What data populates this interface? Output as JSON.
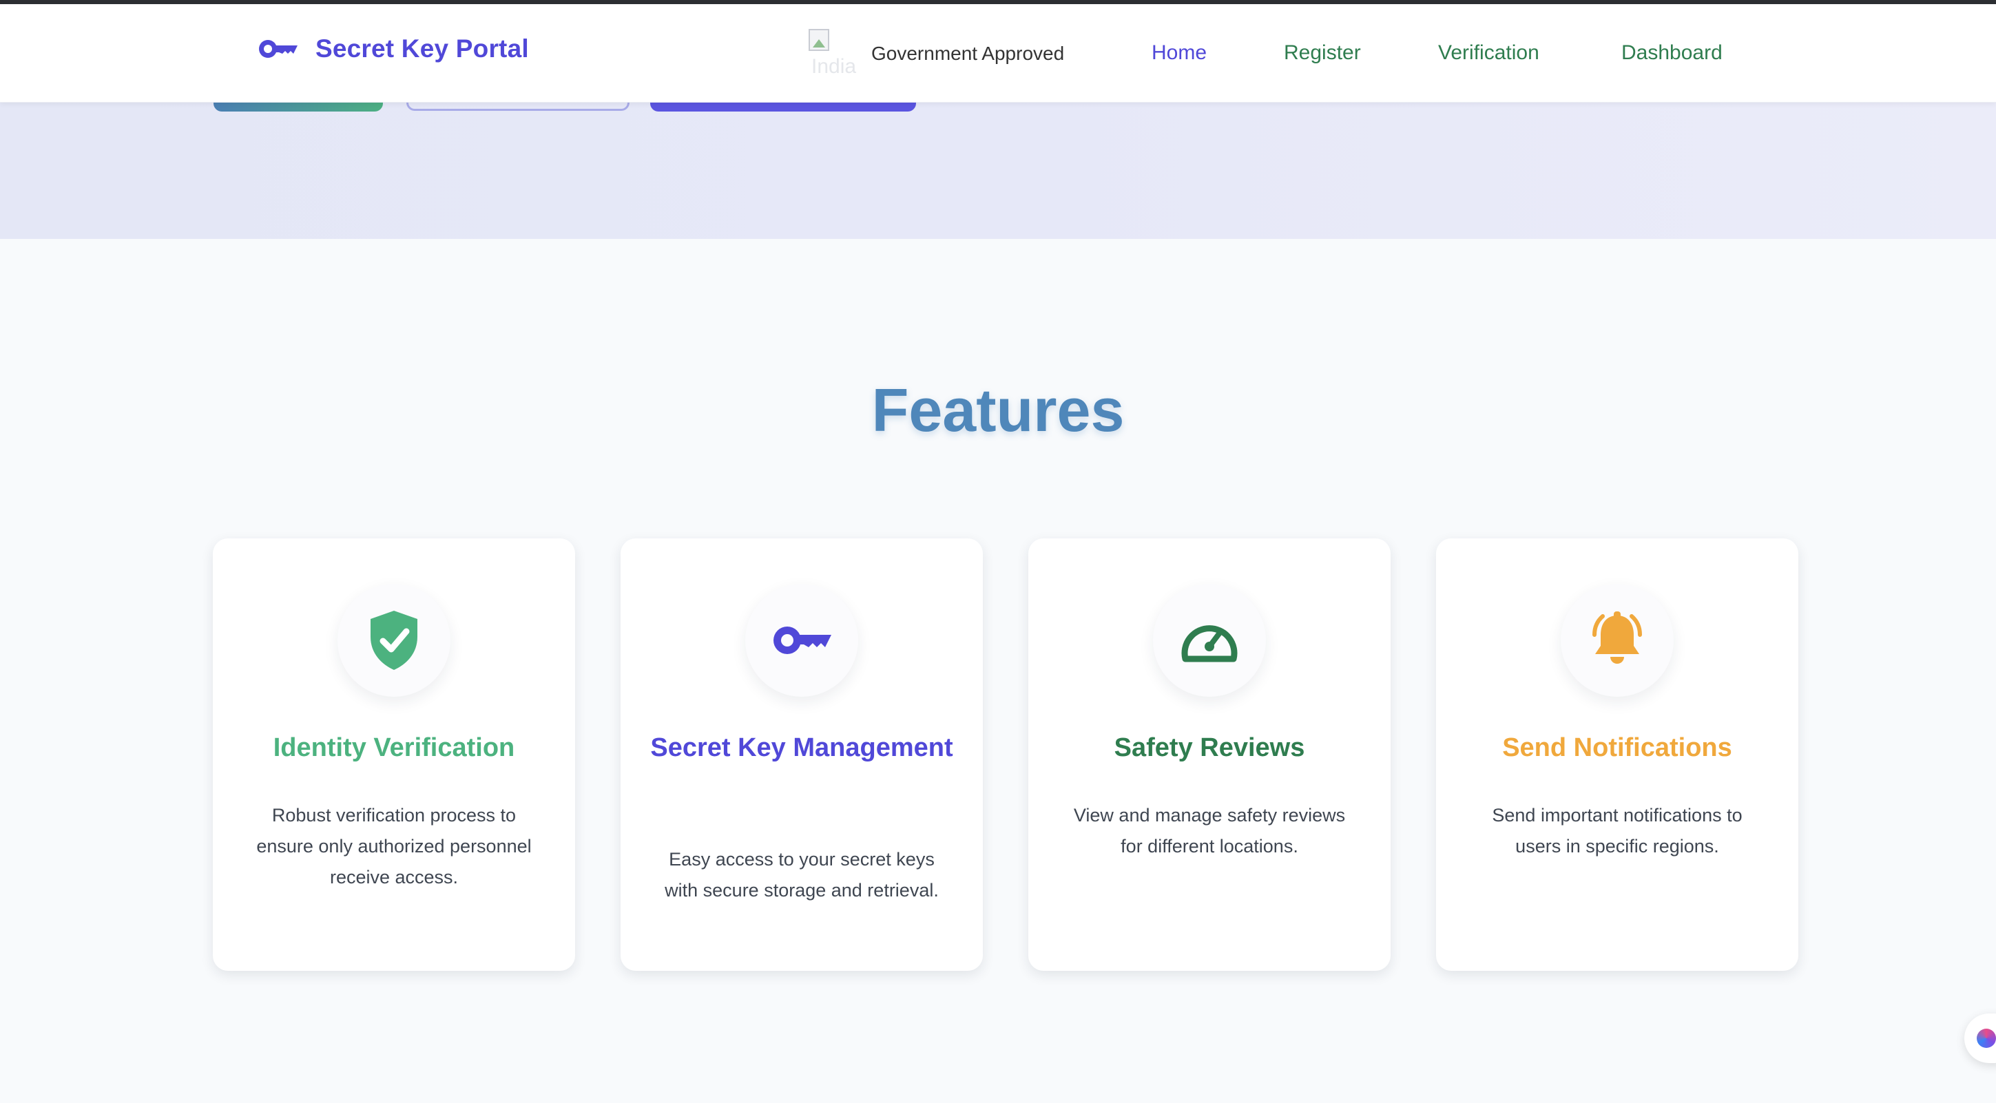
{
  "header": {
    "brand_title": "Secret Key Portal",
    "flag_alt": "India",
    "government_label": "Government Approved",
    "nav": {
      "home": "Home",
      "register": "Register",
      "verification": "Verification",
      "dashboard": "Dashboard"
    },
    "active_nav": "Home"
  },
  "features": {
    "title": "Features",
    "cards": [
      {
        "icon": "shield-check-icon",
        "title": "Identity Verification",
        "description": "Robust verification process to ensure only authorized personnel receive access.",
        "accent": "#4cb27f"
      },
      {
        "icon": "key-icon",
        "title": "Secret Key Management",
        "description": "Easy access to your secret keys with secure storage and retrieval.",
        "accent": "#5048d8"
      },
      {
        "icon": "gauge-icon",
        "title": "Safety Reviews",
        "description": "View and manage safety reviews for different locations.",
        "accent": "#2f7d4f"
      },
      {
        "icon": "bell-icon",
        "title": "Send Notifications",
        "description": "Send important notifications to users in specific regions.",
        "accent": "#f0a83c"
      }
    ]
  },
  "colors": {
    "primary": "#5048d8",
    "nav_green": "#2f7d4f",
    "features_title": "#4f87ba",
    "background": "#f8fafc",
    "hero_background": "#e6e8f8"
  }
}
